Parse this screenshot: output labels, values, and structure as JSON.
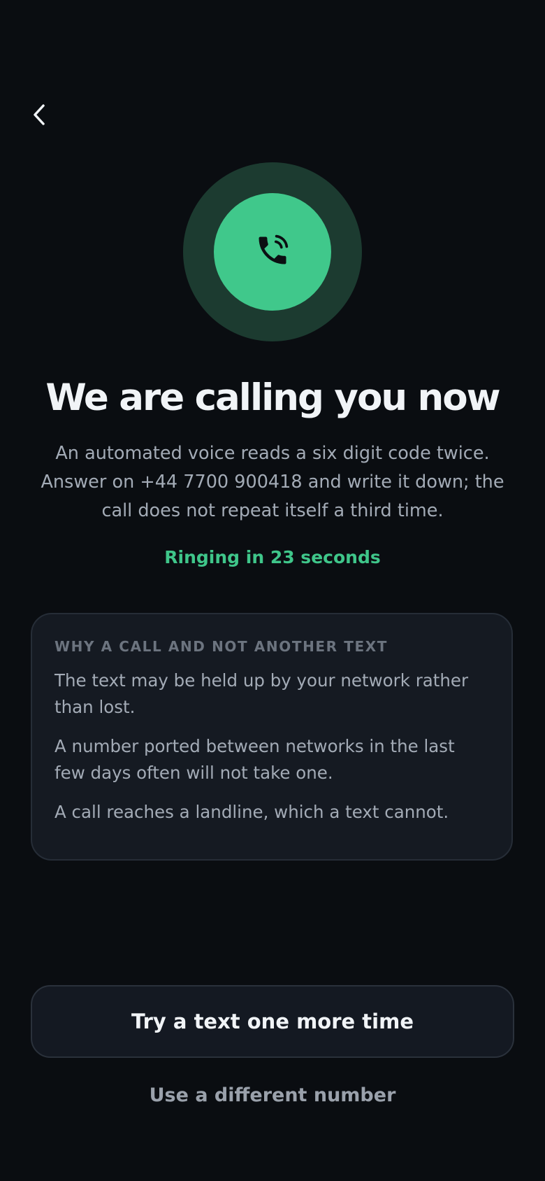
{
  "header": {
    "back_icon": "chevron-left-icon"
  },
  "hero": {
    "icon": "phone-ringing-icon",
    "outer_color": "#1c3b30",
    "inner_color": "#40c88b"
  },
  "title": "We are calling you now",
  "subtitle": "An automated voice reads a six digit code twice. Answer on +44 7700 900418 and write it down; the call does not repeat itself a third time.",
  "ringing_status": "Ringing in 23 seconds",
  "info_card": {
    "heading": "WHY A CALL AND NOT ANOTHER TEXT",
    "paragraphs": [
      "The text may be held up by your network rather than lost.",
      "A number ported between networks in the last few days often will not take one.",
      "A call reaches a landline, which a text cannot."
    ]
  },
  "actions": {
    "primary_label": "Try a text one more time",
    "secondary_label": "Use a different number"
  },
  "colors": {
    "accent": "#3fc68a",
    "background": "#0a0d11"
  }
}
